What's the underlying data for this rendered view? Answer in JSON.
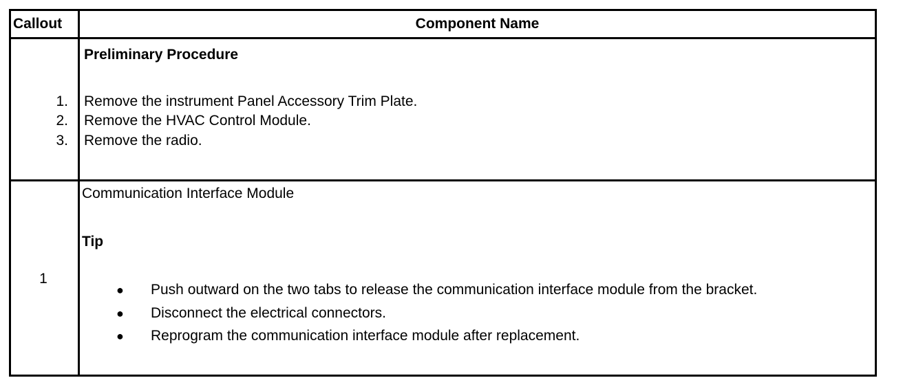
{
  "header": {
    "col_callout": "Callout",
    "col_component": "Component Name"
  },
  "preliminary": {
    "title": "Preliminary Procedure",
    "steps": [
      {
        "num": "1.",
        "text": "Remove the instrument Panel Accessory Trim Plate."
      },
      {
        "num": "2.",
        "text": "Remove the HVAC Control Module."
      },
      {
        "num": "3.",
        "text": "Remove the radio."
      }
    ]
  },
  "callout1": {
    "number": "1",
    "component": "Communication Interface Module",
    "tip_title": "Tip",
    "bullet_glyph": "●",
    "bullets": [
      "Push outward on the two tabs to release the communication interface module from the bracket.",
      "Disconnect the electrical connectors.",
      "Reprogram the communication interface module after replacement."
    ]
  }
}
